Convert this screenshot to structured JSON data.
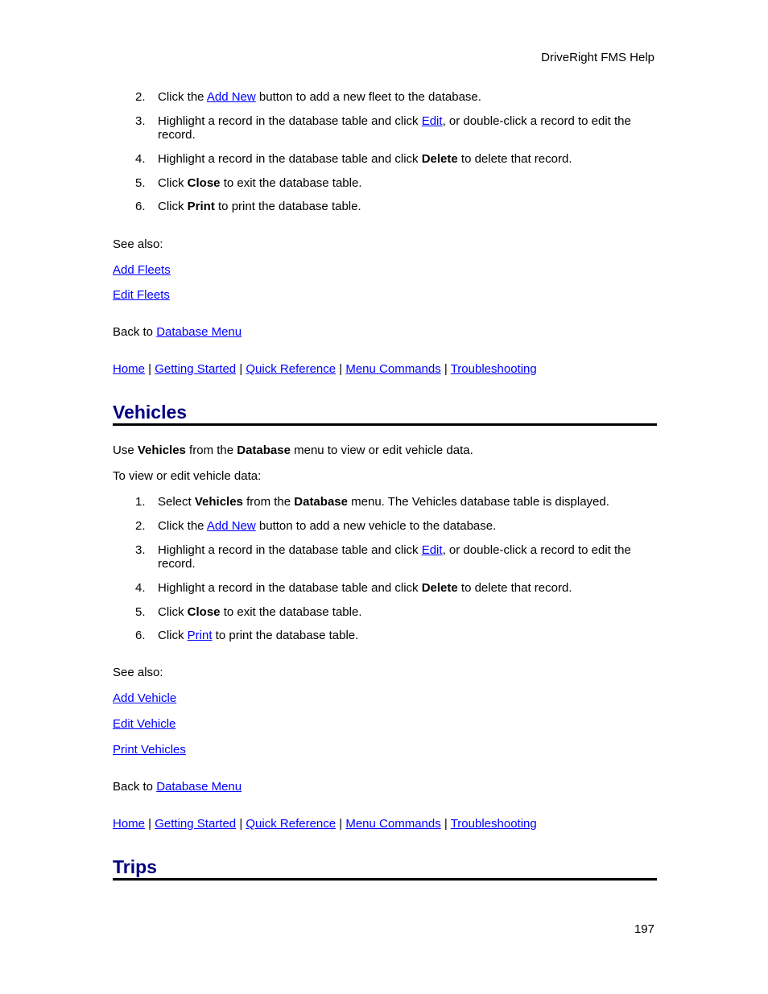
{
  "header": {
    "title": "DriveRight FMS Help"
  },
  "fleets_section": {
    "steps": [
      {
        "num": "2.",
        "parts": [
          {
            "t": "Click the "
          },
          {
            "link": "Add New"
          },
          {
            "t": " button to add a new fleet to the database."
          }
        ]
      },
      {
        "num": "3.",
        "parts": [
          {
            "t": "Highlight a record in the database table and click "
          },
          {
            "link": "Edit"
          },
          {
            "t": ", or double-click a record to edit the record."
          }
        ]
      },
      {
        "num": "4.",
        "parts": [
          {
            "t": "Highlight a record in the database table and click "
          },
          {
            "b": "Delete"
          },
          {
            "t": " to delete that record."
          }
        ]
      },
      {
        "num": "5.",
        "parts": [
          {
            "t": "Click "
          },
          {
            "b": "Close"
          },
          {
            "t": " to exit the database table."
          }
        ]
      },
      {
        "num": "6.",
        "parts": [
          {
            "t": "Click "
          },
          {
            "b": "Print"
          },
          {
            "t": " to print the database table."
          }
        ]
      }
    ],
    "see_also_label": "See also:",
    "see_also_links": [
      "Add Fleets",
      "Edit Fleets"
    ],
    "back_to_label": "Back to ",
    "back_to_link": "Database Menu"
  },
  "nav_links": [
    "Home",
    "Getting Started",
    "Quick Reference",
    "Menu Commands",
    "Troubleshooting"
  ],
  "nav_separator": "|",
  "vehicles_section": {
    "heading": "Vehicles",
    "intro": [
      {
        "t": "Use "
      },
      {
        "b": "Vehicles"
      },
      {
        "t": " from the "
      },
      {
        "b": "Database"
      },
      {
        "t": " menu to view or edit vehicle data."
      }
    ],
    "subintro": "To view or edit vehicle data:",
    "steps": [
      {
        "num": "1.",
        "parts": [
          {
            "t": "Select "
          },
          {
            "b": "Vehicles"
          },
          {
            "t": " from the "
          },
          {
            "b": "Database"
          },
          {
            "t": " menu. The Vehicles database table is displayed."
          }
        ]
      },
      {
        "num": "2.",
        "parts": [
          {
            "t": "Click the "
          },
          {
            "link": "Add New"
          },
          {
            "t": " button to add a new vehicle to the database."
          }
        ]
      },
      {
        "num": "3.",
        "parts": [
          {
            "t": "Highlight a record in the database table and click "
          },
          {
            "link": "Edit"
          },
          {
            "t": ", or double-click a record to edit the record."
          }
        ]
      },
      {
        "num": "4.",
        "parts": [
          {
            "t": "Highlight a record in the database table and click "
          },
          {
            "b": "Delete"
          },
          {
            "t": " to delete that record."
          }
        ]
      },
      {
        "num": "5.",
        "parts": [
          {
            "t": "Click "
          },
          {
            "b": "Close"
          },
          {
            "t": " to exit the database table."
          }
        ]
      },
      {
        "num": "6.",
        "parts": [
          {
            "t": "Click "
          },
          {
            "link": "Print"
          },
          {
            "t": " to print the database table."
          }
        ]
      }
    ],
    "see_also_label": "See also:",
    "see_also_links": [
      "Add Vehicle",
      "Edit Vehicle",
      "Print Vehicles"
    ],
    "back_to_label": "Back to ",
    "back_to_link": "Database Menu"
  },
  "trips_section": {
    "heading": "Trips"
  },
  "footer": {
    "page_number": "197"
  },
  "colors": {
    "link": "#0000ff",
    "heading": "#000080",
    "rule": "#000000"
  }
}
